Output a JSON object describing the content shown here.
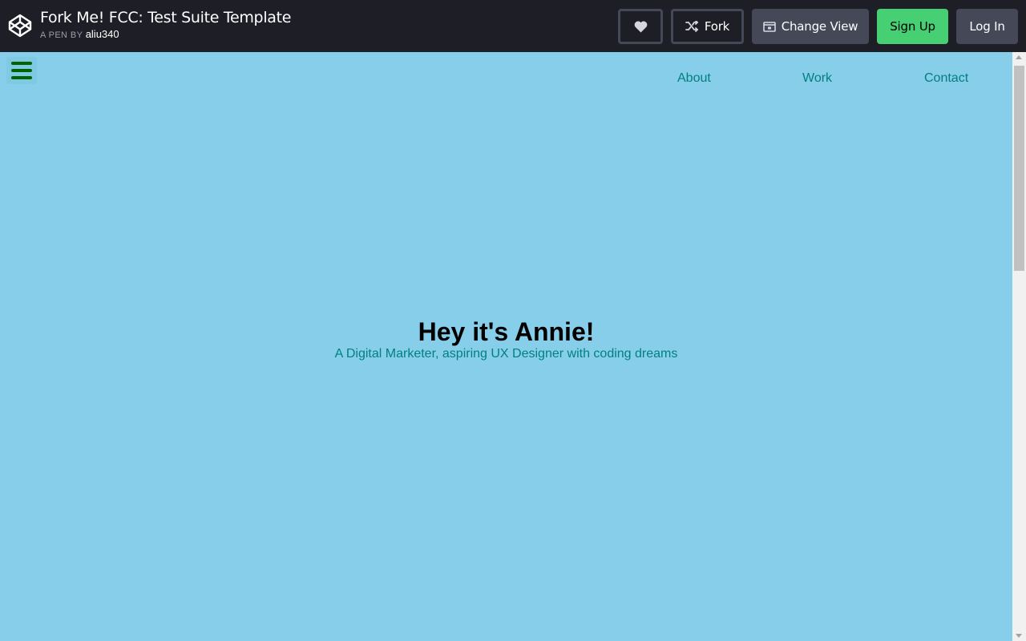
{
  "header": {
    "logo_icon": "codepen-logo-icon",
    "pen_title": "Fork Me! FCC: Test Suite Template",
    "by_label": "A PEN BY",
    "author": "aliu340"
  },
  "actions": {
    "heart_icon": "heart-icon",
    "fork_label": "Fork",
    "fork_icon": "fork-icon",
    "change_view_label": "Change View",
    "change_view_icon": "view-icon",
    "signup_label": "Sign Up",
    "login_label": "Log In"
  },
  "preview": {
    "background": "#87ceeb",
    "menu_icon": "hamburger-icon",
    "nav": [
      {
        "label": "About"
      },
      {
        "label": "Work"
      },
      {
        "label": "Contact"
      }
    ],
    "hero_title": "Hey it's Annie!",
    "hero_subtitle": "A Digital Marketer, aspiring UX Designer with coding dreams"
  },
  "colors": {
    "bar_bg": "#1e1f26",
    "button_gray": "#444857",
    "signup_green": "#47cf73",
    "link_teal": "#008080",
    "menu_green": "#006400"
  }
}
